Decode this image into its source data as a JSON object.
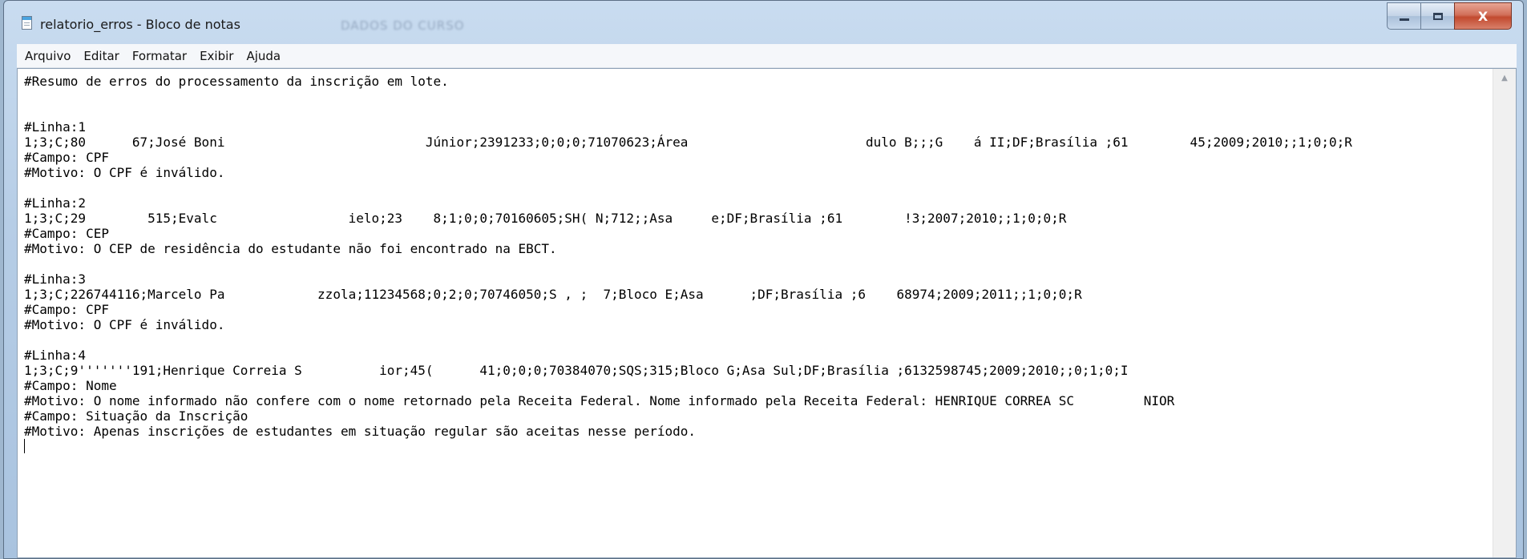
{
  "window": {
    "title": "relatorio_erros - Bloco de notas",
    "background_title": "DADOS DO CURSO",
    "controls": {
      "minimize_icon": "minimize-icon",
      "maximize_icon": "maximize-icon",
      "close_label": "X"
    }
  },
  "menu": {
    "items": [
      "Arquivo",
      "Editar",
      "Formatar",
      "Exibir",
      "Ajuda"
    ]
  },
  "document": {
    "lines": [
      "#Resumo de erros do processamento da inscrição em lote.",
      "",
      "",
      "#Linha:1",
      "1;3;C;80      67;José Boni                          Júnior;2391233;0;0;0;71070623;Área                       dulo B;;;G    á II;DF;Brasília ;61        45;2009;2010;;1;0;0;R",
      "#Campo: CPF",
      "#Motivo: O CPF é inválido.",
      "",
      "#Linha:2",
      "1;3;C;29        515;Evalc                 ielo;23    8;1;0;0;70160605;SH( N;712;;Asa     e;DF;Brasília ;61        !3;2007;2010;;1;0;0;R",
      "#Campo: CEP",
      "#Motivo: O CEP de residência do estudante não foi encontrado na EBCT.",
      "",
      "#Linha:3",
      "1;3;C;226744116;Marcelo Pa            zzola;11234568;0;2;0;70746050;S , ;  7;Bloco E;Asa      ;DF;Brasília ;6    68974;2009;2011;;1;0;0;R",
      "#Campo: CPF",
      "#Motivo: O CPF é inválido.",
      "",
      "#Linha:4",
      "1;3;C;9'''''''191;Henrique Correia S          ior;45(      41;0;0;0;70384070;SQS;315;Bloco G;Asa Sul;DF;Brasília ;6132598745;2009;2010;;0;1;0;I",
      "#Campo: Nome",
      "#Motivo: O nome informado não confere com o nome retornado pela Receita Federal. Nome informado pela Receita Federal: HENRIQUE CORREA SC         NIOR",
      "#Campo: Situação da Inscrição",
      "#Motivo: Apenas inscrições de estudantes em situação regular são aceitas nesse período."
    ]
  },
  "scrollbar": {
    "up_arrow": "▲"
  }
}
